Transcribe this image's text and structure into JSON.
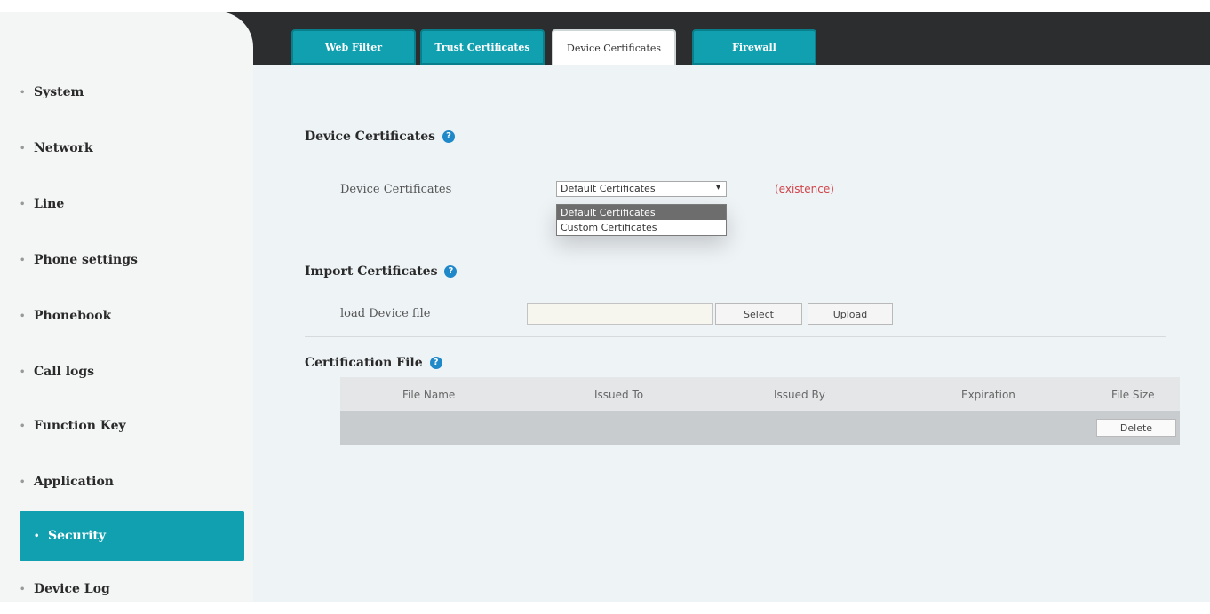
{
  "tabs": [
    {
      "label": "Web Filter",
      "active": false
    },
    {
      "label": "Trust Certificates",
      "active": false
    },
    {
      "label": "Device Certificates",
      "active": true
    },
    {
      "label": "Firewall",
      "active": false
    }
  ],
  "sidebar": {
    "items": [
      {
        "label": "System"
      },
      {
        "label": "Network"
      },
      {
        "label": "Line"
      },
      {
        "label": "Phone settings"
      },
      {
        "label": "Phonebook"
      },
      {
        "label": "Call logs"
      },
      {
        "label": "Function Key"
      },
      {
        "label": "Application"
      },
      {
        "label": "Security",
        "active": true
      },
      {
        "label": "Device Log"
      }
    ]
  },
  "device_section": {
    "title": "Device Certificates",
    "field_label": "Device Certificates",
    "selected": "Default Certificates",
    "options": [
      "Default Certificates",
      "Custom Certificates"
    ],
    "status": "(existence)"
  },
  "import_section": {
    "title": "Import Certificates",
    "field_label": "load Device file",
    "file_value": "",
    "select_label": "Select",
    "upload_label": "Upload"
  },
  "cert_file_section": {
    "title": "Certification File",
    "columns": [
      "File Name",
      "Issued To",
      "Issued By",
      "Expiration",
      "File Size"
    ],
    "delete_label": "Delete"
  },
  "colors": {
    "accent": "#11a0b0",
    "topbar": "#2b2d2f",
    "status_red": "#d0454b",
    "help_blue": "#1f88c8"
  }
}
